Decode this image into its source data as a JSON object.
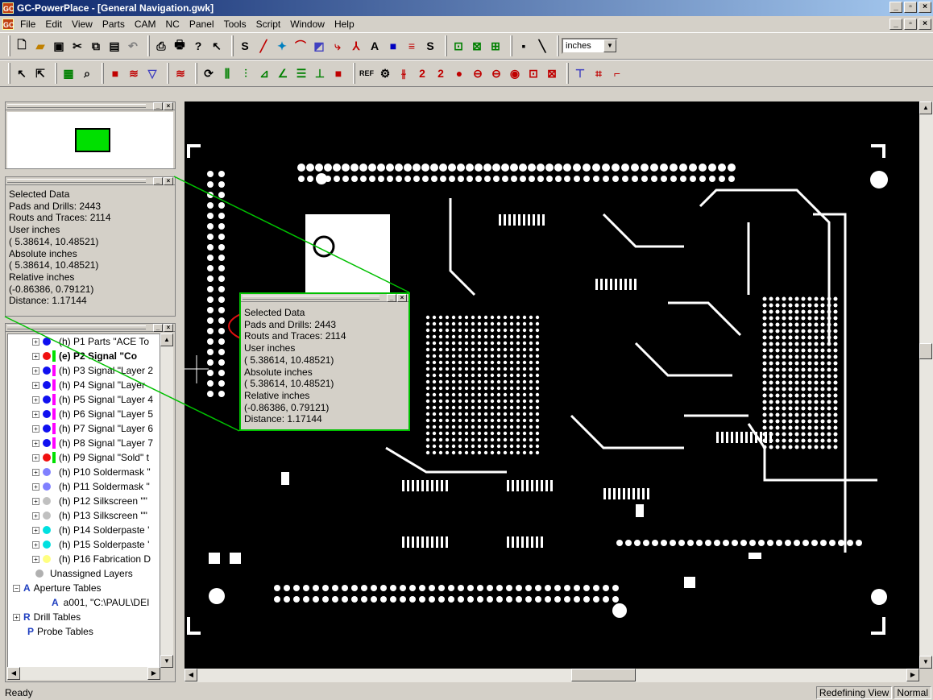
{
  "window": {
    "title": "GC-PowerPlace - [General Navigation.gwk]",
    "app_icon": "GC"
  },
  "menu": [
    "File",
    "Edit",
    "View",
    "Parts",
    "CAM",
    "NC",
    "Panel",
    "Tools",
    "Script",
    "Window",
    "Help"
  ],
  "toolbar": {
    "units_value": "inches"
  },
  "info_panel": {
    "lines": [
      "Selected Data",
      "Pads and Drills: 2443",
      "Routs and Traces: 2114",
      "User inches",
      "( 5.38614, 10.48521)",
      "Absolute inches",
      "( 5.38614, 10.48521)",
      "Relative inches",
      "(-0.86386,  0.79121)",
      "Distance:  1.17144"
    ]
  },
  "layer_tree": {
    "layers": [
      {
        "label": "(h) P1 Parts \"ACE To",
        "dot": "#1010f0",
        "bar": "#ffffff",
        "bold": false
      },
      {
        "label": "(e) P2 Signal \"Co",
        "dot": "#f01010",
        "bar": "#00e000",
        "bold": true
      },
      {
        "label": "(h) P3 Signal \"Layer 2",
        "dot": "#1010f0",
        "bar": "#ff00ff",
        "bold": false
      },
      {
        "label": "(h) P4 Signal \"Layer",
        "dot": "#1010f0",
        "bar": "#ff00ff",
        "bold": false
      },
      {
        "label": "(h) P5 Signal \"Layer 4",
        "dot": "#1010f0",
        "bar": "#ff00ff",
        "bold": false
      },
      {
        "label": "(h) P6 Signal \"Layer 5",
        "dot": "#1010f0",
        "bar": "#ff00ff",
        "bold": false
      },
      {
        "label": "(h) P7 Signal \"Layer 6",
        "dot": "#1010f0",
        "bar": "#ff00ff",
        "bold": false
      },
      {
        "label": "(h) P8 Signal \"Layer 7",
        "dot": "#1010f0",
        "bar": "#ff00ff",
        "bold": false
      },
      {
        "label": "(h) P9 Signal \"Sold\" t",
        "dot": "#f01010",
        "bar": "#00e000",
        "bold": false
      },
      {
        "label": "(h) P10 Soldermask \"",
        "dot": "#8080ff",
        "bar": "#ffffff",
        "bold": false
      },
      {
        "label": "(h) P11 Soldermask \"",
        "dot": "#8080ff",
        "bar": "#ffffff",
        "bold": false
      },
      {
        "label": "(h) P12 Silkscreen \"\"",
        "dot": "#c0c0c0",
        "bar": "#ffffff",
        "bold": false
      },
      {
        "label": "(h) P13 Silkscreen \"\"",
        "dot": "#c0c0c0",
        "bar": "#ffffff",
        "bold": false
      },
      {
        "label": "(h) P14 Solderpaste '",
        "dot": "#00e0e0",
        "bar": "#ffffff",
        "bold": false
      },
      {
        "label": "(h) P15 Solderpaste '",
        "dot": "#00e0e0",
        "bar": "#ffffff",
        "bold": false
      },
      {
        "label": "(h) P16 Fabrication D",
        "dot": "#ffff80",
        "bar": "#ffffff",
        "bold": false
      }
    ],
    "unassigned": "Unassigned Layers",
    "aperture_tables": "Aperture Tables",
    "aperture_item": "a001, \"C:\\PAUL\\DEI",
    "drill_tables": "Drill Tables",
    "probe_tables": "Probe Tables"
  },
  "status": {
    "left": "Ready",
    "mode": "Redefining View",
    "state": "Normal"
  },
  "colors": {
    "highlight_green": "#00c000",
    "annotation_red": "#e01010"
  }
}
